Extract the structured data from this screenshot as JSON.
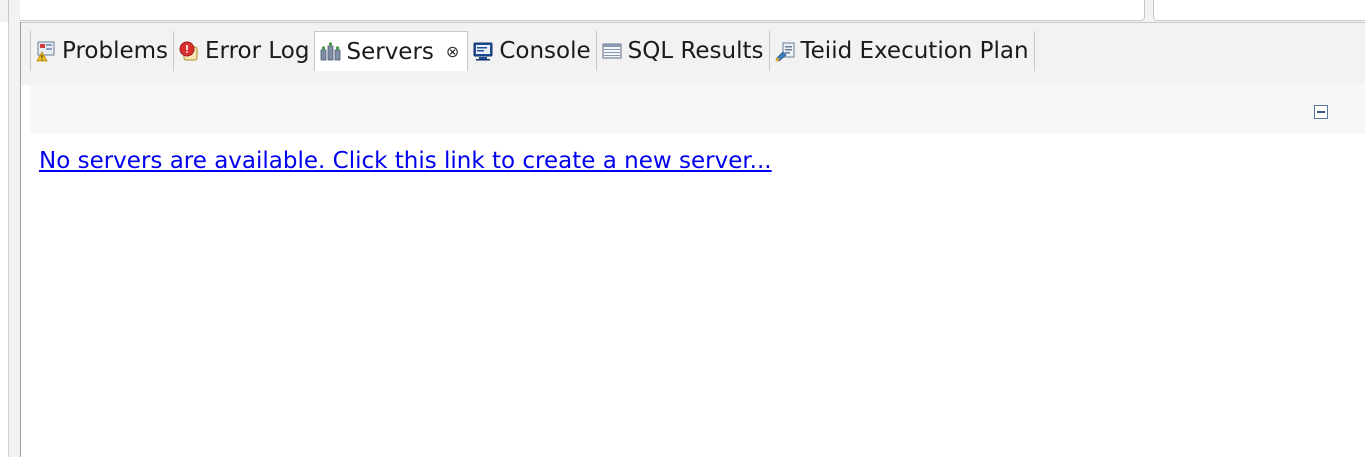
{
  "tabs": [
    {
      "label": "Problems",
      "icon": "problems-icon",
      "active": false
    },
    {
      "label": "Error Log",
      "icon": "error-log-icon",
      "active": false
    },
    {
      "label": "Servers",
      "icon": "servers-icon",
      "active": true,
      "close": "⊗"
    },
    {
      "label": "Console",
      "icon": "console-icon",
      "active": false
    },
    {
      "label": "SQL Results",
      "icon": "sql-results-icon",
      "active": false
    },
    {
      "label": "Teiid Execution Plan",
      "icon": "execution-plan-icon",
      "active": false
    }
  ],
  "servers_view": {
    "empty_link": "No servers are available. Click this link to create a new server..."
  },
  "colors": {
    "link": "#0000ee",
    "tab_background": "#f2f2f2",
    "active_tab_background": "#ffffff"
  }
}
